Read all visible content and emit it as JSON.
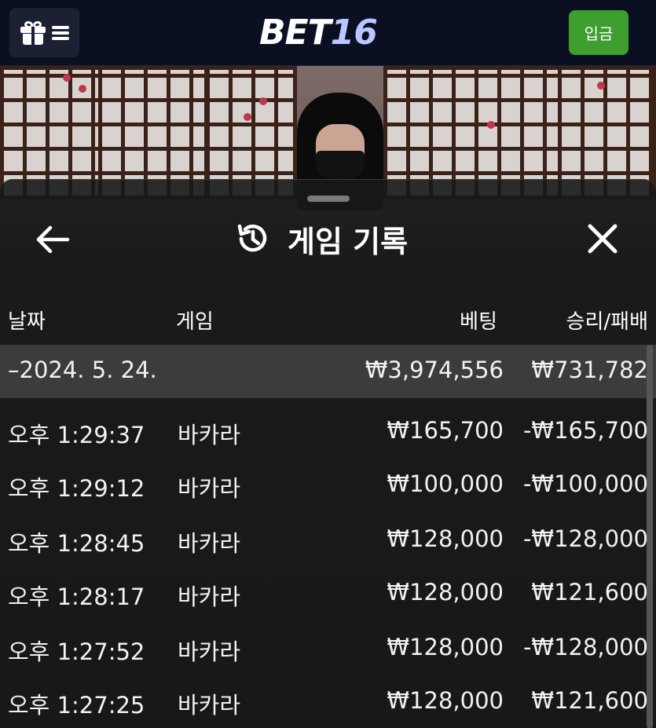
{
  "header": {
    "logo_bet": "BET",
    "logo_num": "16",
    "deposit_label": "입금"
  },
  "sheet": {
    "title": "게임 기록",
    "columns": [
      "날짜",
      "게임",
      "베팅",
      "승리/패배"
    ],
    "date_group": {
      "label": "–2024. 5. 24.",
      "total_bet": "₩3,974,556",
      "total_result": "₩731,782"
    },
    "rows": [
      {
        "time": "오후 1:29:37",
        "game": "바카라",
        "bet": "₩165,700",
        "result": "-₩165,700"
      },
      {
        "time": "오후 1:29:12",
        "game": "바카라",
        "bet": "₩100,000",
        "result": "-₩100,000"
      },
      {
        "time": "오후 1:28:45",
        "game": "바카라",
        "bet": "₩128,000",
        "result": "-₩128,000"
      },
      {
        "time": "오후 1:28:17",
        "game": "바카라",
        "bet": "₩128,000",
        "result": "₩121,600"
      },
      {
        "time": "오후 1:27:52",
        "game": "바카라",
        "bet": "₩128,000",
        "result": "-₩128,000"
      },
      {
        "time": "오후 1:27:25",
        "game": "바카라",
        "bet": "₩128,000",
        "result": "₩121,600"
      }
    ]
  },
  "icons": {
    "menu": "gift-icon",
    "back": "arrow-left-icon",
    "history": "history-icon",
    "close": "close-icon"
  },
  "colors": {
    "topbar_bg": "#0b0f22",
    "deposit_green": "#3e9e2f",
    "logo_accent": "#b9c8ff"
  }
}
